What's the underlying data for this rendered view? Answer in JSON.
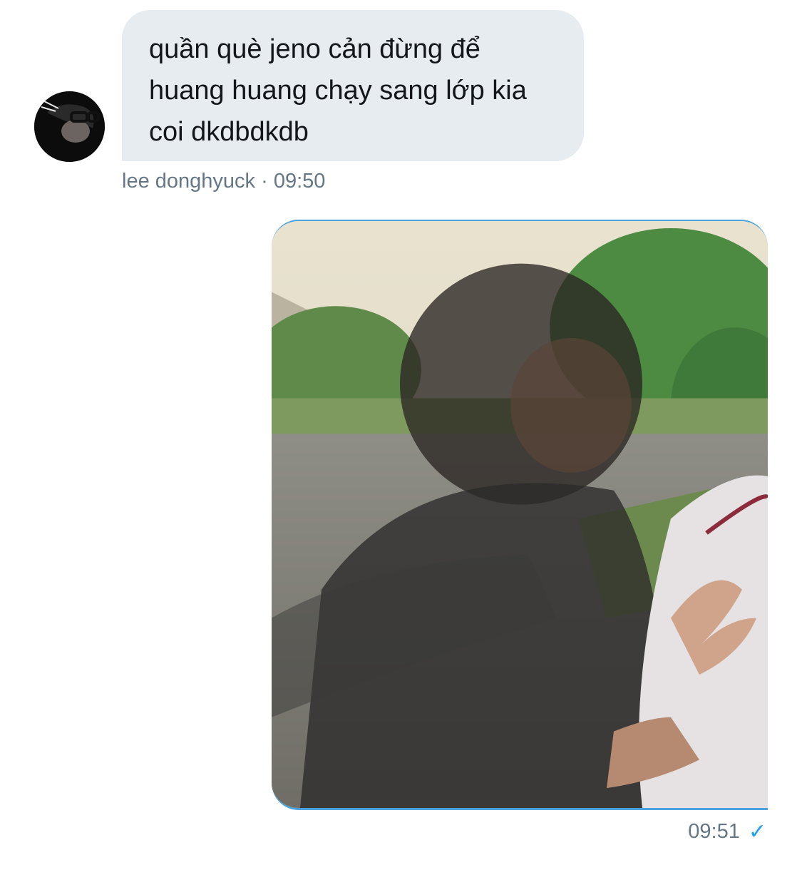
{
  "incoming_message": {
    "text": "quần què jeno cản đừng để huang huang chạy sang lớp kia coi dkdbdkdb",
    "sender": "lee donghyuck",
    "separator": "·",
    "time": "09:50"
  },
  "outgoing_message": {
    "time": "09:51",
    "status_icon": "checkmark-icon"
  },
  "colors": {
    "incoming_bubble": "#e6ecf0",
    "meta_text": "#657786",
    "accent": "#1da1f2"
  }
}
